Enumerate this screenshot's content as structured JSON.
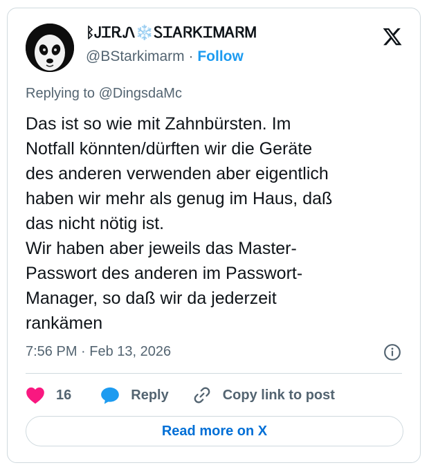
{
  "tweet": {
    "display_name": "ᛒᎫᏆᎡᏁ❄️ᏚᏆᎪᏒᏦᏆᎷᎪᏒᎷ",
    "handle": "@BStarkimarm",
    "separator": "·",
    "follow_label": "Follow",
    "replying_to": "Replying to @DingsdaMc",
    "text": "Das ist so wie mit Zahnbürsten. Im\nNotfall könnten/dürften wir die Geräte\ndes anderen verwenden aber eigentlich\nhaben wir mehr als genug im Haus, daß\ndas nicht nötig ist.\nWir haben aber jeweils das Master-\nPasswort des anderen im Passwort-\nManager, so daß wir da jederzeit\nrankämen",
    "timestamp": "7:56 PM · Feb 13, 2026"
  },
  "actions": {
    "like_count": "16",
    "reply_label": "Reply",
    "copy_link_label": "Copy link to post",
    "read_more_label": "Read more on X"
  },
  "colors": {
    "like": "#f91880",
    "reply": "#1d9bf0",
    "link": "#006fd6",
    "follow": "#1d9bf0"
  }
}
